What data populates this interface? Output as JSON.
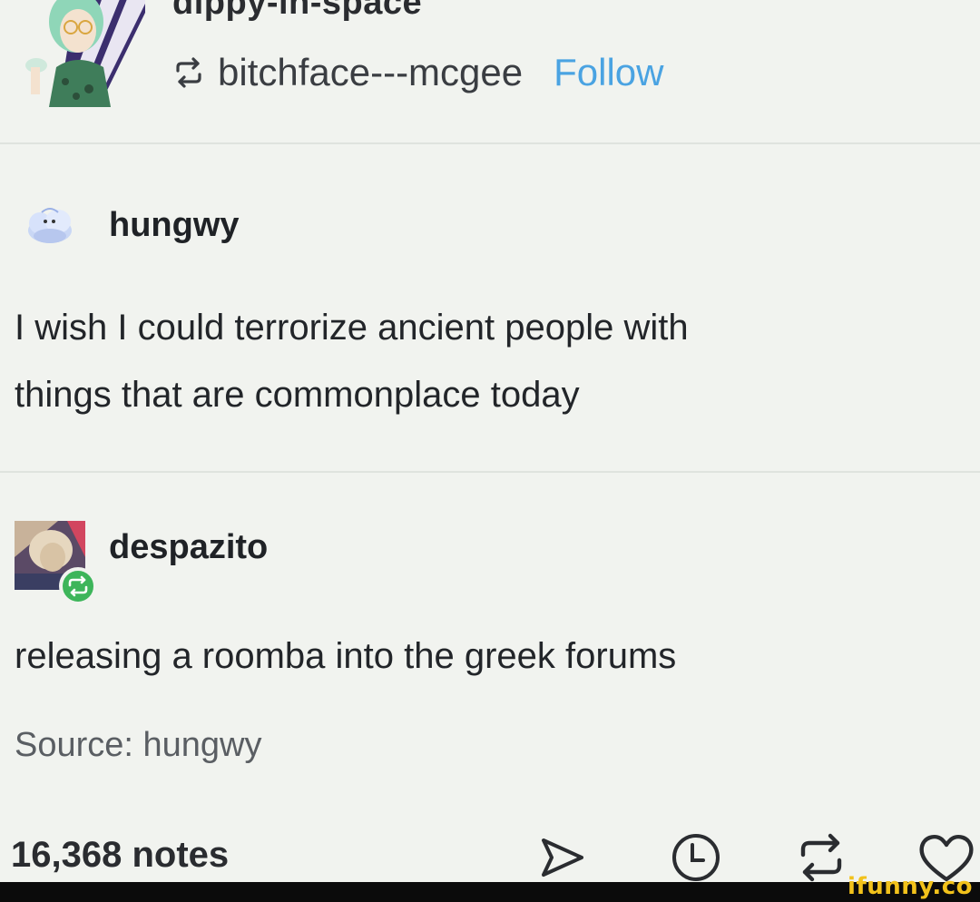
{
  "header": {
    "blog_name": "dippy-in-space",
    "reblogged_from": "bitchface---mcgee",
    "follow_label": "Follow"
  },
  "posts": [
    {
      "username": "hungwy",
      "text_lines": [
        "I wish I could terrorize ancient people with",
        "things that are commonplace today"
      ]
    },
    {
      "username": "despazito",
      "text_lines": [
        "releasing a roomba into the greek forums"
      ]
    }
  ],
  "source": "Source: hungwy",
  "footer": {
    "notes": "16,368 notes",
    "icons": [
      "share-icon",
      "reply-icon",
      "reblog-icon",
      "like-icon"
    ]
  },
  "watermark": "ifunny.co",
  "colors": {
    "background": "#f1f3ef",
    "follow": "#4aa3e2",
    "reblog_badge": "#3db55a",
    "watermark": "#f2c21b"
  }
}
